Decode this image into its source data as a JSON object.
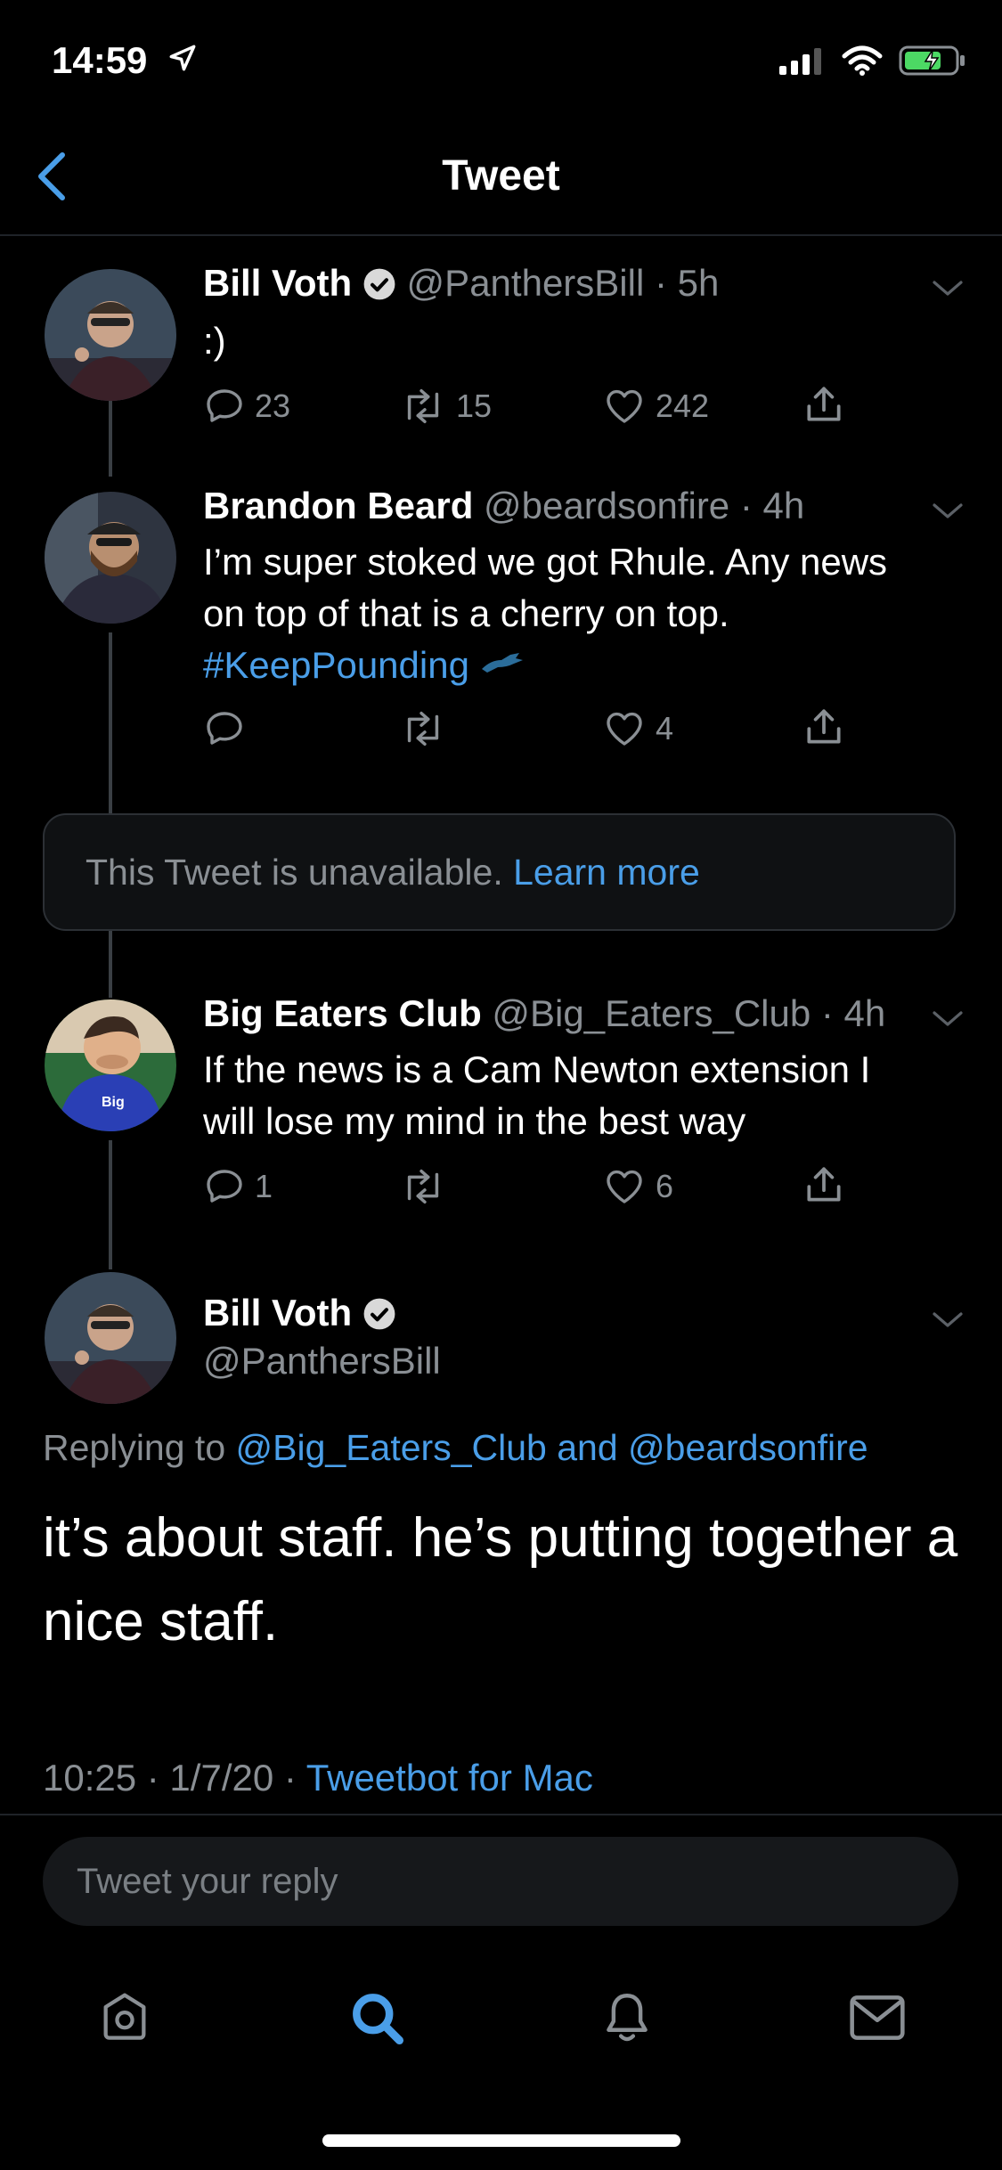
{
  "status_bar": {
    "time": "14:59"
  },
  "nav": {
    "title": "Tweet"
  },
  "tweets": [
    {
      "name": "Bill Voth",
      "handle": "@PanthersBill",
      "age": "· 5h",
      "text": ":)",
      "replies": "23",
      "retweets": "15",
      "likes": "242"
    },
    {
      "name": "Brandon Beard",
      "handle": "@beardsonfire",
      "age": "· 4h",
      "text_line1": "I’m super stoked we got Rhule. Any news",
      "text_line2": "on top of that is a cherry on top.",
      "hashtag": "#KeepPounding",
      "replies": "",
      "retweets": "",
      "likes": "4"
    },
    {
      "name": "Big Eaters Club",
      "handle": "@Big_Eaters_Club",
      "age": "· 4h",
      "text_line1": "If the news is a Cam Newton extension I",
      "text_line2": "will lose my mind in the best way",
      "replies": "1",
      "retweets": "",
      "likes": "6"
    }
  ],
  "unavailable": {
    "text": "This Tweet is unavailable.",
    "link": "Learn more"
  },
  "main_tweet": {
    "name": "Bill Voth",
    "handle": "@PanthersBill",
    "replying_prefix": "Replying to",
    "replying_users": "@Big_Eaters_Club and @beardsonfire",
    "text": "it’s about staff. he’s putting together a nice staff.",
    "timestamp": "10:25 · 1/7/20 ·",
    "source": "Tweetbot for Mac"
  },
  "reply": {
    "placeholder": "Tweet your reply"
  },
  "colors": {
    "accent": "#4a9ee8",
    "background": "#000000",
    "muted": "#8a8f94",
    "battery": "#4cd964"
  },
  "tabs": [
    "home-icon",
    "search-icon",
    "notifications-icon",
    "messages-icon"
  ],
  "active_tab": "search-icon"
}
